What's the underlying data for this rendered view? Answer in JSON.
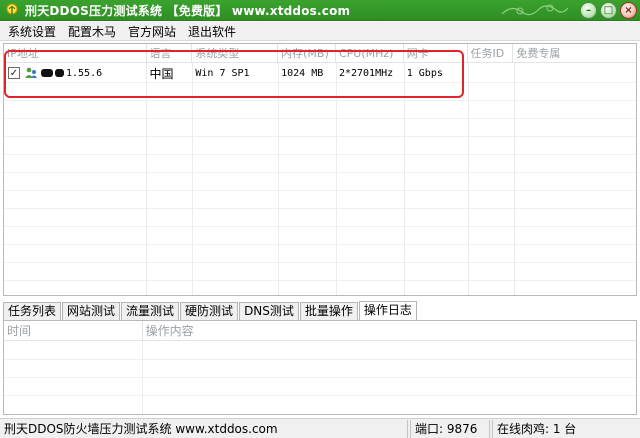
{
  "window": {
    "title": "刑天DDOS压力测试系统 【免费版】 www.xtddos.com",
    "icon": "app-leaf-icon",
    "controls": [
      "minimize",
      "maximize",
      "close"
    ],
    "accent_color": "#34992a"
  },
  "menu": {
    "items": [
      "系统设置",
      "配置木马",
      "官方网站",
      "退出软件"
    ]
  },
  "list": {
    "columns": [
      "IP地址",
      "语言",
      "系统类型",
      "内存(MB)",
      "CPU(MHz)",
      "网卡",
      "任务ID",
      "免费专属"
    ],
    "rows": [
      {
        "checked": true,
        "checkbox_glyph": "✓",
        "ip": "1.55.6",
        "language": "中国",
        "os": "Win 7 SP1",
        "memory": "1024 MB",
        "cpu": "2*2701MHz",
        "nic": "1 Gbps",
        "task_id": "",
        "free": ""
      }
    ],
    "highlight_color": "#e0242a"
  },
  "tabs": {
    "items": [
      "任务列表",
      "网站测试",
      "流量测试",
      "硬防测试",
      "DNS测试",
      "批量操作",
      "操作日志"
    ],
    "active": "操作日志"
  },
  "log": {
    "columns": [
      "时间",
      "操作内容"
    ]
  },
  "status": {
    "product": "刑天DDOS防火墙压力测试系统 www.xtddos.com",
    "port": "端口: 9876",
    "online": "在线肉鸡: 1 台"
  }
}
